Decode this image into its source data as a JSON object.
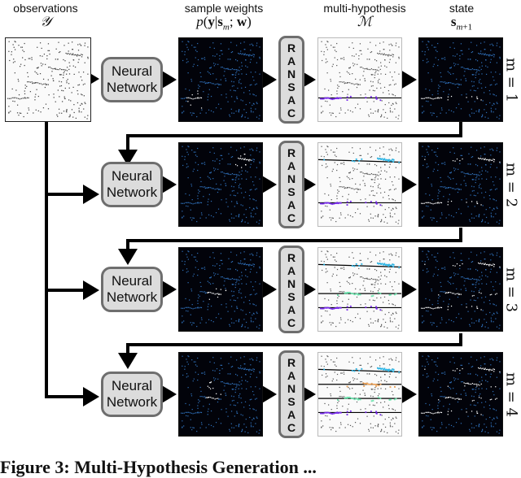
{
  "headers": {
    "observations": {
      "label": "observations",
      "symbol": "𝒴"
    },
    "sample_weights": {
      "label": "sample weights",
      "symbol": "p(y|s_m; w)"
    },
    "multi_hypothesis": {
      "label": "multi-hypothesis",
      "symbol": "ℳ"
    },
    "state": {
      "label": "state",
      "symbol": "s_{m+1}"
    }
  },
  "blocks": {
    "neural_network": "Neural\nNetwork",
    "ransac_letters": [
      "R",
      "A",
      "N",
      "S",
      "A",
      "C"
    ]
  },
  "rows": [
    {
      "m_label": "m = 1",
      "hypothesis_colors": [
        "#7a2cf0"
      ]
    },
    {
      "m_label": "m = 2",
      "hypothesis_colors": [
        "#29b6e8",
        "#7a2cf0"
      ]
    },
    {
      "m_label": "m = 3",
      "hypothesis_colors": [
        "#29b6e8",
        "#6ee6b0",
        "#7a2cf0"
      ]
    },
    {
      "m_label": "m = 4",
      "hypothesis_colors": [
        "#29b6e8",
        "#f0a860",
        "#6ee6b0",
        "#7a2cf0"
      ]
    }
  ],
  "colors": {
    "block_fill": "#dcdcdc",
    "block_border": "#6e6e6e",
    "dark_panel": "#02030a",
    "weight_points": "#2f6fb8",
    "selected_points": "#ffffff"
  },
  "caption": "Figure 3: Multi-Hypothesis Generation ... "
}
